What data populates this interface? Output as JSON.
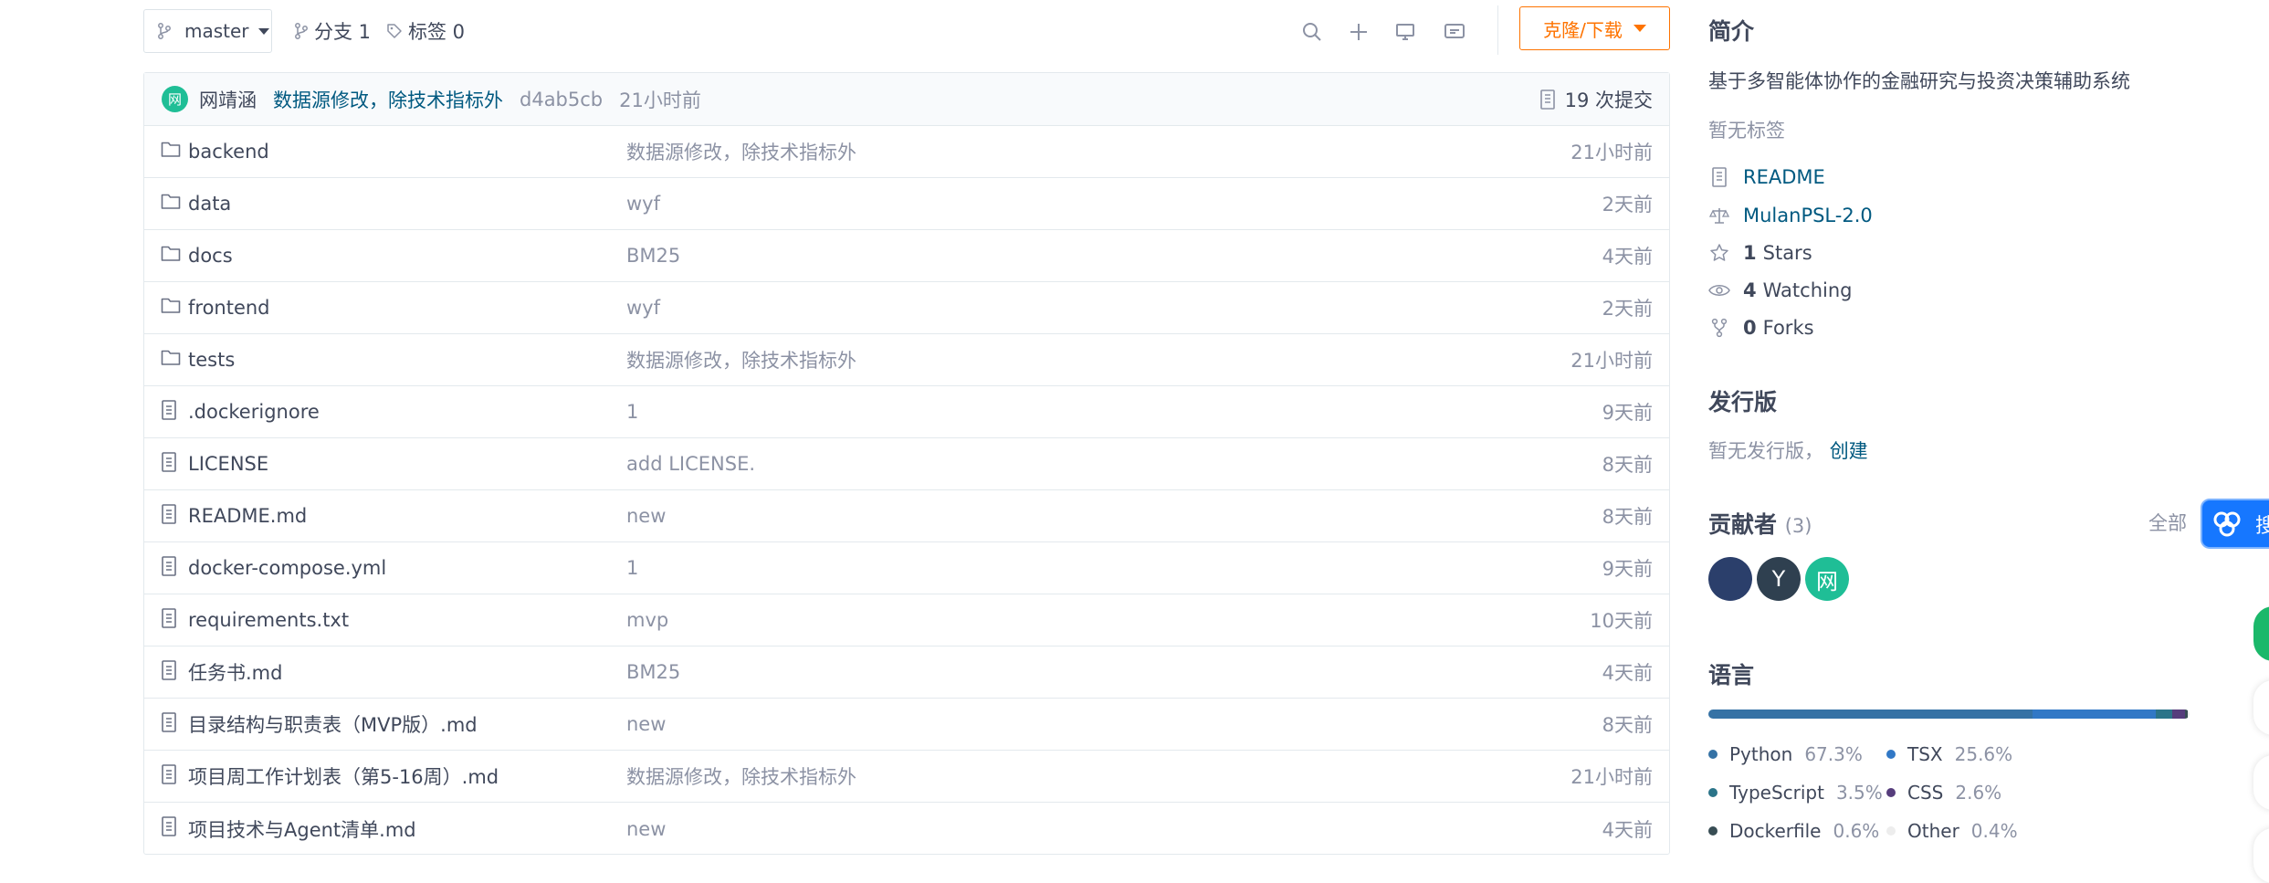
{
  "toolbar": {
    "branch": "master",
    "branches": "分支 1",
    "tags": "标签 0",
    "clone_label": "克隆/下载"
  },
  "commit": {
    "avatar_char": "网",
    "author": "网靖涵",
    "message": "数据源修改，除技术指标外",
    "hash": "d4ab5cb",
    "time": "21小时前",
    "count": "19 次提交"
  },
  "files": [
    {
      "type": "folder",
      "name": "backend",
      "message": "数据源修改，除技术指标外",
      "time": "21小时前"
    },
    {
      "type": "folder",
      "name": "data",
      "message": "wyf",
      "time": "2天前"
    },
    {
      "type": "folder",
      "name": "docs",
      "message": "BM25",
      "time": "4天前"
    },
    {
      "type": "folder",
      "name": "frontend",
      "message": "wyf",
      "time": "2天前"
    },
    {
      "type": "folder",
      "name": "tests",
      "message": "数据源修改，除技术指标外",
      "time": "21小时前"
    },
    {
      "type": "file",
      "name": ".dockerignore",
      "message": "1",
      "time": "9天前"
    },
    {
      "type": "file",
      "name": "LICENSE",
      "message": "add LICENSE.",
      "time": "8天前"
    },
    {
      "type": "file",
      "name": "README.md",
      "message": "new",
      "time": "8天前"
    },
    {
      "type": "file",
      "name": "docker-compose.yml",
      "message": "1",
      "time": "9天前"
    },
    {
      "type": "file",
      "name": "requirements.txt",
      "message": "mvp",
      "time": "10天前"
    },
    {
      "type": "file",
      "name": "任务书.md",
      "message": "BM25",
      "time": "4天前"
    },
    {
      "type": "file",
      "name": "目录结构与职责表（MVP版）.md",
      "message": "new",
      "time": "8天前"
    },
    {
      "type": "file",
      "name": "项目周工作计划表（第5-16周）.md",
      "message": "数据源修改，除技术指标外",
      "time": "21小时前"
    },
    {
      "type": "file",
      "name": "项目技术与Agent清单.md",
      "message": "new",
      "time": "4天前"
    }
  ],
  "sidebar": {
    "intro_title": "简介",
    "description": "基于多智能体协作的金融研究与投资决策辅助系统",
    "no_tags": "暂无标签",
    "readme": "README",
    "license": "MulanPSL-2.0",
    "stars_count": "1",
    "stars_label": "Stars",
    "watching_count": "4",
    "watching_label": "Watching",
    "forks_count": "0",
    "forks_label": "Forks",
    "release_title": "发行版",
    "no_release": "暂无发行版，",
    "create_link": "创建",
    "contributors_title": "贡献者",
    "contributors_count": "(3)",
    "all_link": "全部",
    "contributors": [
      {
        "initial": "",
        "color": "#2b3f6b"
      },
      {
        "initial": "Y",
        "color": "#2f4050"
      },
      {
        "initial": "网",
        "color": "#1fbe96"
      }
    ],
    "languages_title": "语言",
    "languages": [
      {
        "name": "Python",
        "percent": "67.3%",
        "value": 67.3,
        "color": "#3572a5"
      },
      {
        "name": "TSX",
        "percent": "25.6%",
        "value": 25.6,
        "color": "#3178c6"
      },
      {
        "name": "TypeScript",
        "percent": "3.5%",
        "value": 3.5,
        "color": "#2b7489"
      },
      {
        "name": "CSS",
        "percent": "2.6%",
        "value": 2.6,
        "color": "#563d7c"
      },
      {
        "name": "Dockerfile",
        "percent": "0.6%",
        "value": 0.6,
        "color": "#384d54"
      },
      {
        "name": "Other",
        "percent": "0.4%",
        "value": 0.4,
        "color": "#ededed"
      }
    ]
  },
  "widgets": {
    "float_char": "搜"
  }
}
